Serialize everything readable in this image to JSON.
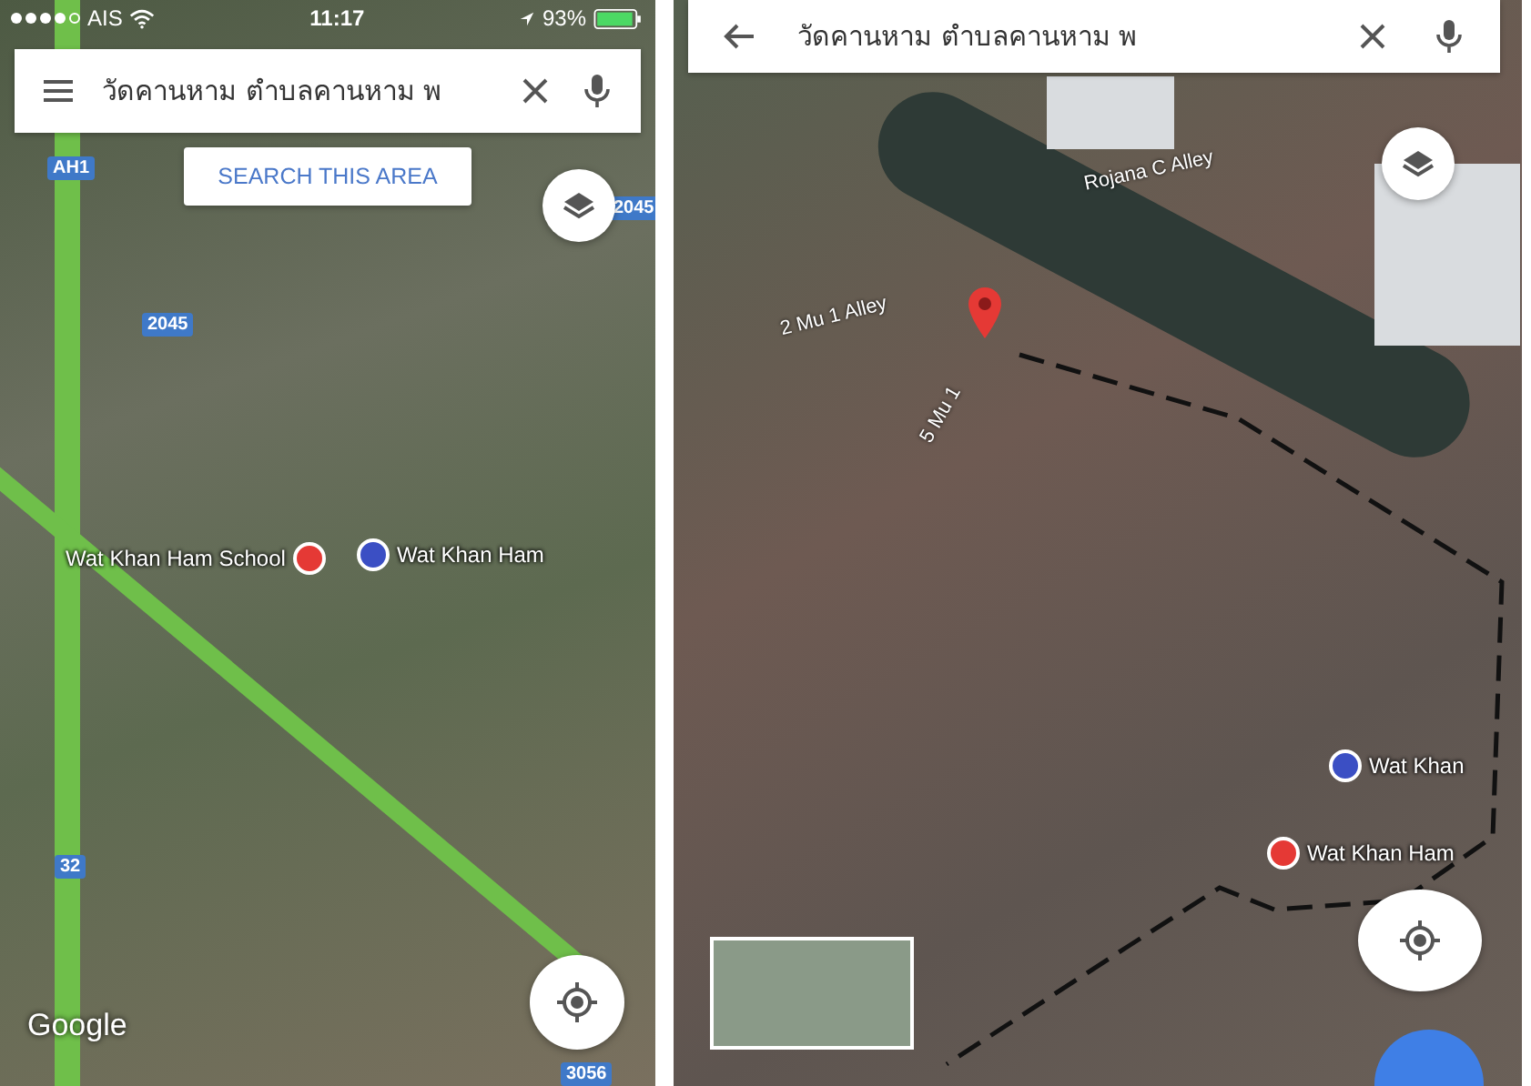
{
  "left": {
    "status_bar": {
      "carrier": "AIS",
      "time": "11:17",
      "battery": "93%"
    },
    "search": {
      "value": "วัดคานหาม ตำบลคานหาม พ"
    },
    "search_area_button": "SEARCH THIS AREA",
    "labels": [
      {
        "kind": "shield",
        "text": "AH1"
      },
      {
        "kind": "shield",
        "text": "2045"
      },
      {
        "kind": "shield",
        "text": "2045"
      },
      {
        "kind": "school",
        "text": "Wat Khan Ham School"
      },
      {
        "kind": "temple",
        "text": "Wat Khan Ham"
      },
      {
        "kind": "shield",
        "text": "32"
      },
      {
        "kind": "shield",
        "text": "3056"
      }
    ],
    "logo": "Google"
  },
  "right": {
    "search": {
      "value": "วัดคานหาม ตำบลคานหาม พ"
    },
    "labels": [
      {
        "kind": "street",
        "text": "Rojana C Alley"
      },
      {
        "kind": "street",
        "text": "2 Mu 1 Alley"
      },
      {
        "kind": "street",
        "text": "5 Mu 1"
      },
      {
        "kind": "temple",
        "text": "Wat Khan"
      },
      {
        "kind": "school",
        "text": "Wat Khan Ham"
      }
    ]
  }
}
